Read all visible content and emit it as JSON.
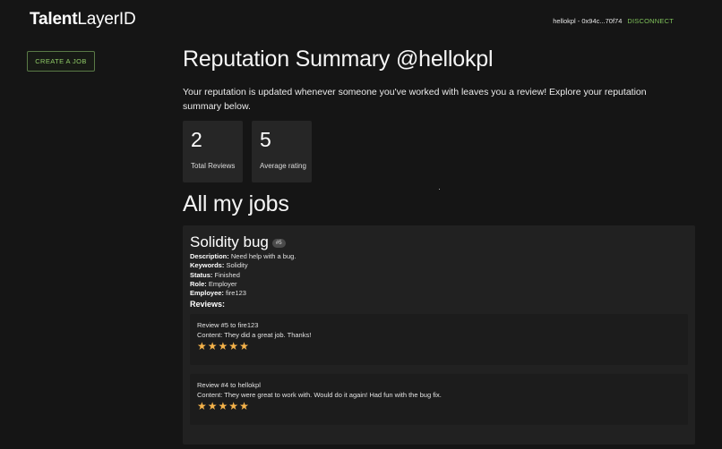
{
  "header": {
    "logo_bold": "Talent",
    "logo_rest": "LayerID",
    "account_label": "hellokpl - 0x94c...70f74",
    "disconnect_label": "DISCONNECT"
  },
  "sidebar": {
    "create_job_label": "CREATE A JOB"
  },
  "summary": {
    "title": "Reputation Summary @hellokpl",
    "intro": "Your reputation is updated whenever someone you've worked with leaves you a review! Explore your reputation summary below.",
    "stats": [
      {
        "value": "2",
        "label": "Total Reviews"
      },
      {
        "value": "5",
        "label": "Average rating"
      }
    ]
  },
  "jobs": {
    "title": "All my jobs",
    "items": [
      {
        "title": "Solidity bug",
        "badge": "#5",
        "description_label": "Description:",
        "description": "Need help with a bug.",
        "keywords_label": "Keywords:",
        "keywords": "Solidity",
        "status_label": "Status:",
        "status": "Finished",
        "role_label": "Role:",
        "role": "Employer",
        "employee_label": "Employee:",
        "employee": "fire123",
        "reviews_label": "Reviews:",
        "reviews": [
          {
            "heading": "Review #5 to fire123",
            "content": "Content: They did a great job. Thanks!",
            "rating": 5
          },
          {
            "heading": "Review #4 to hellokpl",
            "content": "Content: They were great to work with. Would do it again! Had fun with the bug fix.",
            "rating": 5
          }
        ]
      }
    ]
  },
  "colors": {
    "background": "#151515",
    "card": "#262626",
    "accent_green": "#7fc15a",
    "star": "#f4b24a"
  }
}
